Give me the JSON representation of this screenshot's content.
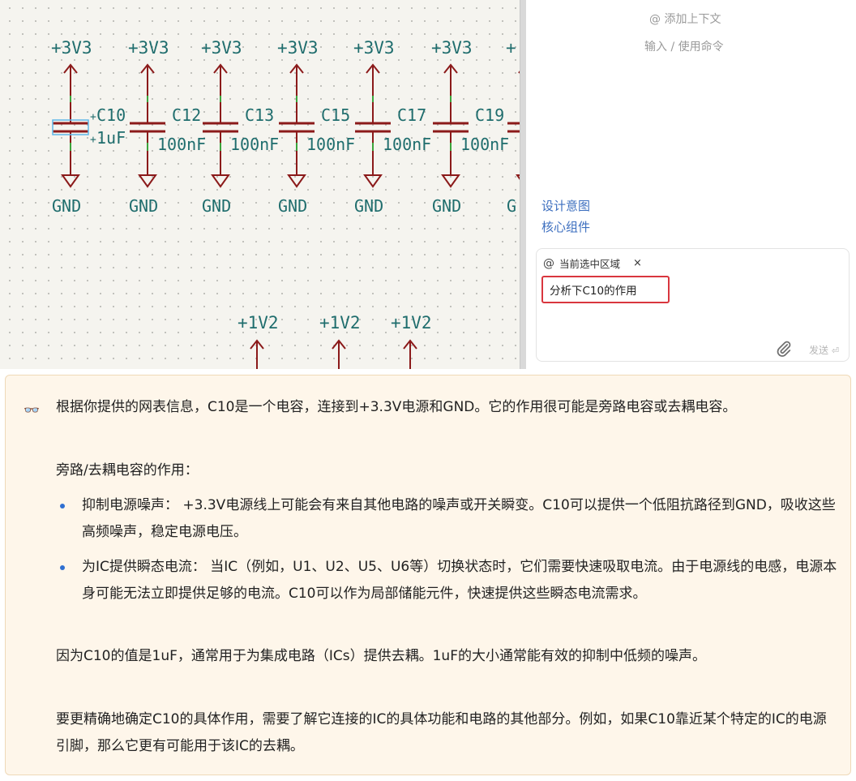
{
  "schematic": {
    "power_labels": [
      "+3V3",
      "+3V3",
      "+3V3",
      "+3V3",
      "+3V3",
      "+3V3",
      "+"
    ],
    "gnd_labels": [
      "GND",
      "GND",
      "GND",
      "GND",
      "GND",
      "GND",
      "G"
    ],
    "capacitors": [
      {
        "ref": "C10",
        "value": "1uF",
        "selected": true
      },
      {
        "ref": "C12",
        "value": "100nF"
      },
      {
        "ref": "C13",
        "value": "100nF"
      },
      {
        "ref": "C15",
        "value": "100nF"
      },
      {
        "ref": "C17",
        "value": "100nF"
      },
      {
        "ref": "C19",
        "value": "100nF"
      }
    ],
    "plus_prefix": "+",
    "v12_labels": [
      "+1V2",
      "+1V2",
      "+1V2"
    ]
  },
  "chat": {
    "add_context_hint": "@ 添加上下文",
    "command_hint": "输入 / 使用命令",
    "context_links": [
      "设计意图",
      "核心组件"
    ],
    "chip_at": "@",
    "chip_label": "当前选中区域",
    "chip_close": "×",
    "input_value": "分析下C10的作用",
    "send_label": "发送",
    "attach_icon": "paperclip-icon"
  },
  "response": {
    "icon": "👓",
    "intro": "根据你提供的网表信息，C10是一个电容，连接到+3.3V电源和GND。它的作用很可能是旁路电容或去耦电容。",
    "heading": "旁路/去耦电容的作用：",
    "bullets": [
      "抑制电源噪声： +3.3V电源线上可能会有来自其他电路的噪声或开关瞬变。C10可以提供一个低阻抗路径到GND，吸收这些高频噪声，稳定电源电压。",
      "为IC提供瞬态电流： 当IC（例如，U1、U2、U5、U6等）切换状态时，它们需要快速吸取电流。由于电源线的电感，电源本身可能无法立即提供足够的电流。C10可以作为局部储能元件，快速提供这些瞬态电流需求。"
    ],
    "para_value": "因为C10的值是1uF，通常用于为集成电路（ICs）提供去耦。1uF的大小通常能有效的抑制中低频的噪声。",
    "para_more": "要更精确地确定C10的具体作用，需要了解它连接的IC的具体功能和电路的其他部分。例如，如果C10靠近某个特定的IC的电源引脚，那么它更有可能用于该IC的去耦。"
  },
  "colors": {
    "wire": "#8b1a1a",
    "label": "#1f6d6d",
    "selection": "#5fb7e8",
    "link": "#3d6fbf",
    "highlight_border": "#d9363e",
    "response_bg": "#fef6ea"
  }
}
